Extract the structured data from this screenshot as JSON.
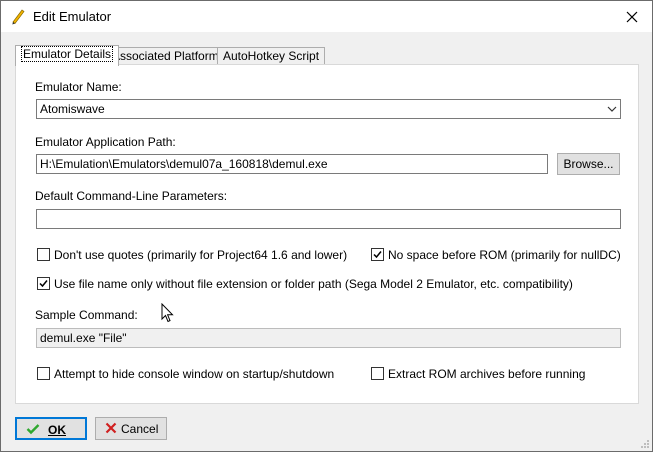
{
  "window": {
    "title": "Edit Emulator"
  },
  "tabs": [
    {
      "label": "Emulator Details"
    },
    {
      "label": "Associated Platforms"
    },
    {
      "label": "AutoHotkey Script"
    }
  ],
  "details": {
    "emulator_name_label": "Emulator Name:",
    "emulator_name_value": "Atomiswave",
    "app_path_label": "Emulator Application Path:",
    "app_path_value": "H:\\Emulation\\Emulators\\demul07a_160818\\demul.exe",
    "browse_label": "Browse...",
    "cmd_params_label": "Default Command-Line Parameters:",
    "cmd_params_value": "",
    "dont_use_quotes_label": "Don't use quotes (primarily for Project64 1.6 and lower)",
    "dont_use_quotes_checked": false,
    "no_space_label": "No space before ROM (primarily for nullDC)",
    "no_space_checked": true,
    "file_name_only_label": "Use file name only without file extension or folder path (Sega Model 2 Emulator, etc. compatibility)",
    "file_name_only_checked": true,
    "sample_command_label": "Sample Command:",
    "sample_command_value": "demul.exe \"File\"",
    "hide_console_label": "Attempt to hide console window on startup/shutdown",
    "hide_console_checked": false,
    "extract_rom_label": "Extract ROM archives before running",
    "extract_rom_checked": false
  },
  "footer": {
    "ok_label": "OK",
    "cancel_label": "Cancel"
  },
  "colors": {
    "accent": "#0078d7",
    "ok_check": "#2fa82f",
    "cancel_x": "#d02020"
  }
}
